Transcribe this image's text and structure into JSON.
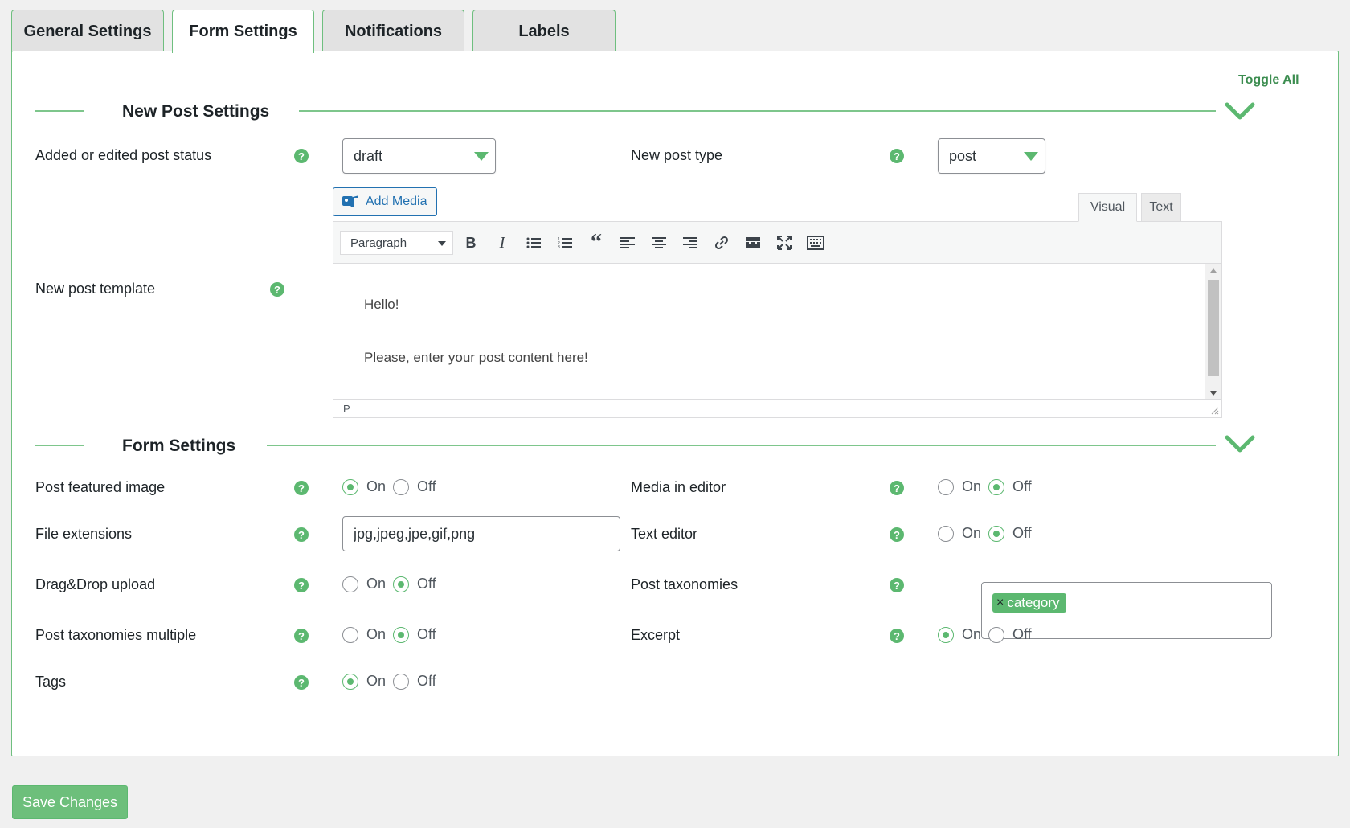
{
  "tabs": [
    {
      "label": "General Settings",
      "active": false
    },
    {
      "label": "Form Settings",
      "active": true
    },
    {
      "label": "Notifications",
      "active": false
    },
    {
      "label": "Labels",
      "active": false
    }
  ],
  "toggle_all": "Toggle All",
  "new_post_section": {
    "title": "New Post Settings",
    "post_status_label": "Added or edited post status",
    "post_status_value": "draft",
    "post_type_label": "New post type",
    "post_type_value": "post",
    "template_label": "New post template",
    "add_media": "Add Media",
    "editor_tabs": {
      "visual": "Visual",
      "text": "Text"
    },
    "paragraph_select": "Paragraph",
    "content_line1": "Hello!",
    "content_line2": "Please, enter your post content here!",
    "status_path": "P"
  },
  "form_section": {
    "title": "Form Settings",
    "on_label": "On",
    "off_label": "Off",
    "featured_image": {
      "label": "Post featured image",
      "value": "On"
    },
    "media_in_editor": {
      "label": "Media in editor",
      "value": "Off"
    },
    "file_extensions": {
      "label": "File extensions",
      "value": "jpg,jpeg,jpe,gif,png"
    },
    "text_editor": {
      "label": "Text editor",
      "value": "Off"
    },
    "drag_drop": {
      "label": "Drag&Drop upload",
      "value": "Off"
    },
    "post_taxonomies": {
      "label": "Post taxonomies",
      "chip": "category"
    },
    "taxonomies_multiple": {
      "label": "Post taxonomies multiple",
      "value": "Off"
    },
    "excerpt": {
      "label": "Excerpt",
      "value": "On"
    },
    "tags": {
      "label": "Tags",
      "value": "On"
    }
  },
  "save_button": "Save Changes",
  "colors": {
    "accent": "#5cb870",
    "link": "#2271b1"
  }
}
